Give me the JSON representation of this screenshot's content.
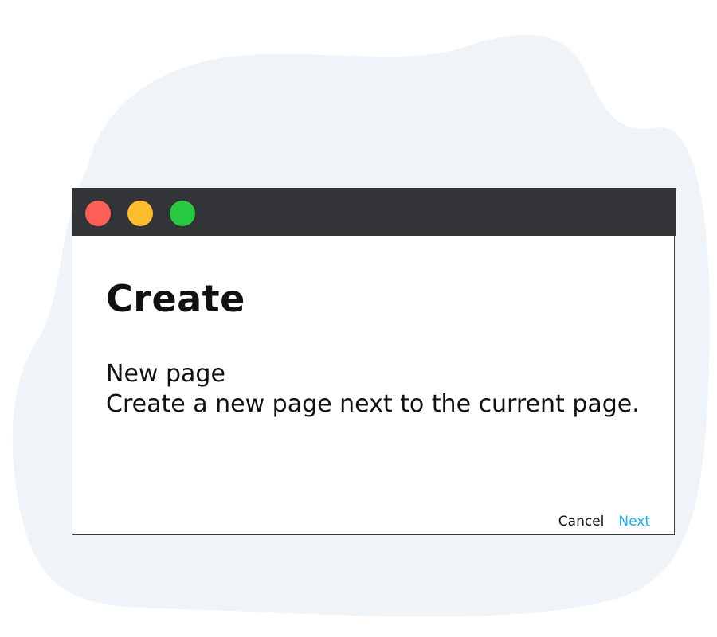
{
  "colors": {
    "background_blob": "#eff4f9",
    "titlebar": "#333438",
    "close_dot": "#fe5f57",
    "minimize_dot": "#febc2e",
    "maximize_dot": "#28c840",
    "next_button": "#1ab3e8",
    "text": "#111111"
  },
  "window": {
    "controls": [
      "close-dot-icon",
      "minimize-dot-icon",
      "maximize-dot-icon"
    ]
  },
  "dialog": {
    "title": "Create",
    "option": {
      "title": "New page",
      "description": "Create a new page next to the current page."
    },
    "cancel_label": "Cancel",
    "next_label": "Next"
  }
}
